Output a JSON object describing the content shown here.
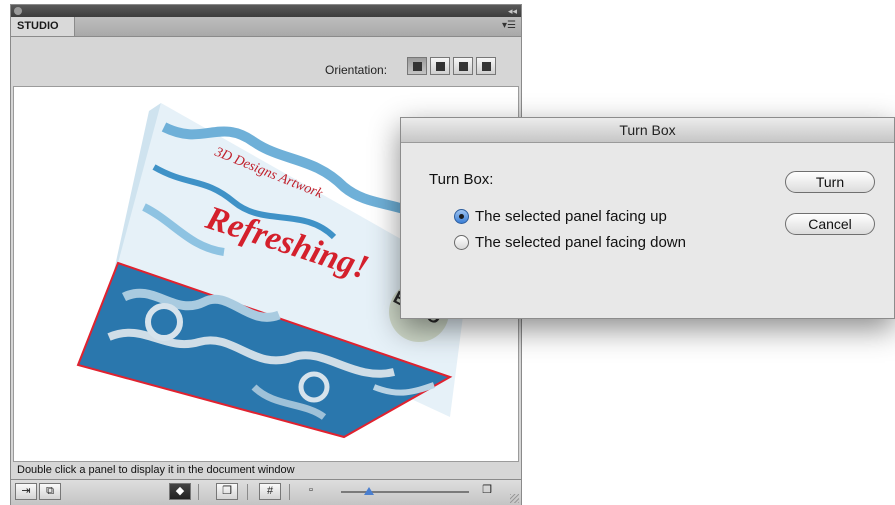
{
  "panel": {
    "tab_label": "STUDIO",
    "orientation_label": "Orientation:",
    "orientation_buttons": [
      "orient-front-icon",
      "orient-left-icon",
      "orient-top-icon",
      "orient-right-icon"
    ],
    "hint": "Double click a panel to display it in the document window",
    "zoom_fraction": 0.22
  },
  "preview": {
    "brand_text": "3D Designs Artwork",
    "slogan": "Refreshing!",
    "logo_text": "ESKO",
    "box_colors": {
      "light": "#e6f1f8",
      "dark": "#2a77ad",
      "accent": "#e0222f"
    }
  },
  "dialog": {
    "title": "Turn Box",
    "label": "Turn Box:",
    "options": [
      {
        "label": "The selected panel facing up",
        "checked": true
      },
      {
        "label": "The selected panel facing down",
        "checked": false
      }
    ],
    "turn_button": "Turn",
    "cancel_button": "Cancel"
  }
}
